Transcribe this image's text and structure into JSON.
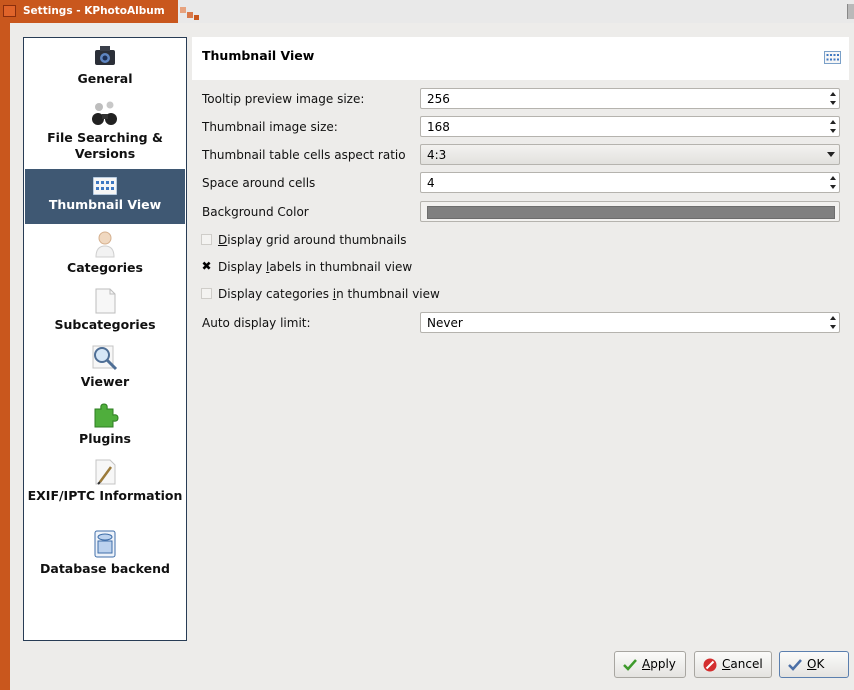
{
  "window": {
    "title": "Settings - KPhotoAlbum"
  },
  "sidebar": {
    "items": [
      {
        "label": "General",
        "icon": "camera-icon",
        "selected": false
      },
      {
        "label": "File Searching & Versions",
        "icon": "binoculars-icon",
        "selected": false
      },
      {
        "label": "Thumbnail View",
        "icon": "thumbnail-grid-icon",
        "selected": true
      },
      {
        "label": "Categories",
        "icon": "person-icon",
        "selected": false
      },
      {
        "label": "Subcategories",
        "icon": "document-icon",
        "selected": false
      },
      {
        "label": "Viewer",
        "icon": "magnifier-icon",
        "selected": false
      },
      {
        "label": "Plugins",
        "icon": "puzzle-piece-icon",
        "selected": false
      },
      {
        "label": "EXIF/IPTC Information",
        "icon": "pen-icon",
        "selected": false
      },
      {
        "label": "Database backend",
        "icon": "database-icon",
        "selected": false
      }
    ]
  },
  "page": {
    "title": "Thumbnail View",
    "icon": "thumbnail-grid-icon"
  },
  "form": {
    "tooltip_preview_label": "Tooltip preview image size:",
    "tooltip_preview_value": "256",
    "thumbnail_size_label": "Thumbnail image size:",
    "thumbnail_size_value": "168",
    "aspect_ratio_label": "Thumbnail table cells aspect ratio",
    "aspect_ratio_value": "4:3",
    "space_label": "Space around cells",
    "space_value": "4",
    "bg_color_label": "Background Color",
    "bg_color_value": "#808080",
    "grid_checkbox": {
      "label_pre": "",
      "label_key": "D",
      "label_post": "isplay grid around thumbnails",
      "checked": false
    },
    "labels_checkbox": {
      "label_pre": "Display ",
      "label_key": "l",
      "label_post": "abels in thumbnail view",
      "checked": true
    },
    "categories_checkbox": {
      "label_pre": "Display categories ",
      "label_key": "i",
      "label_post": "n thumbnail view",
      "checked": false
    },
    "auto_display_label": "Auto display limit:",
    "auto_display_value": "Never"
  },
  "buttons": {
    "apply": {
      "key": "A",
      "rest": "pply",
      "icon": "checkmark-icon"
    },
    "cancel": {
      "key": "C",
      "rest": "ancel",
      "icon": "cancel-icon"
    },
    "ok": {
      "key": "O",
      "rest": "K",
      "icon": "checkmark-icon"
    }
  },
  "colors": {
    "accent": "#c9571d",
    "selection": "#3f5873",
    "sidebar_border": "#283c55"
  }
}
